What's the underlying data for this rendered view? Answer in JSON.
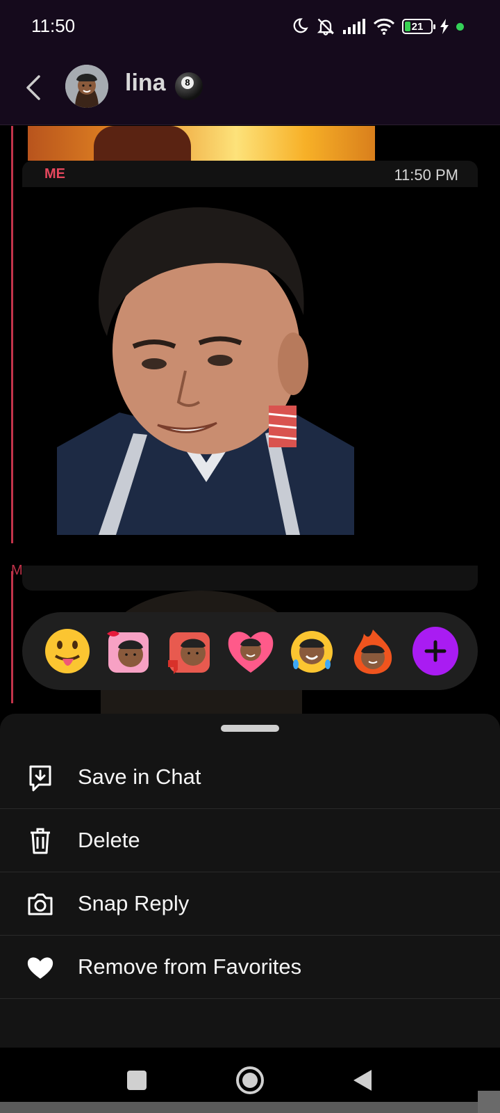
{
  "status_bar": {
    "time": "11:50",
    "battery": "21",
    "battery_level": 0.21,
    "icons": [
      "moon-icon",
      "bell-off-icon",
      "signal-icon",
      "wifi-icon",
      "battery-icon",
      "charging-icon",
      "green-dot-icon"
    ]
  },
  "header": {
    "contact_name": "lina",
    "eightball_label": "8",
    "back_icon": "back-chevron-icon"
  },
  "chat": {
    "message": {
      "sender": "ME",
      "time": "11:50 PM"
    },
    "second_sender_initial": "M"
  },
  "reactions": [
    {
      "name": "tongue-emoji",
      "glyph": "😛"
    },
    {
      "name": "bitmoji-kiss",
      "glyph": "💋"
    },
    {
      "name": "bitmoji-thumbs-down",
      "glyph": "👎"
    },
    {
      "name": "bitmoji-heart",
      "glyph": "❤"
    },
    {
      "name": "bitmoji-laughing",
      "glyph": "😂"
    },
    {
      "name": "bitmoji-fire",
      "glyph": "🔥"
    }
  ],
  "add_reaction_icon": "plus-icon",
  "menu": {
    "items": [
      {
        "label": "Save in Chat",
        "icon": "save-in-chat-icon"
      },
      {
        "label": "Delete",
        "icon": "trash-icon"
      },
      {
        "label": "Snap Reply",
        "icon": "camera-icon"
      },
      {
        "label": "Remove from Favorites",
        "icon": "heart-icon"
      }
    ]
  },
  "nav": {
    "buttons": [
      "recents-square-icon",
      "home-circle-icon",
      "back-triangle-icon"
    ]
  },
  "colors": {
    "accent_red": "#e5475d",
    "accent_purple": "#a91cf2",
    "header_bg": "#150a1c",
    "sheet_bg": "#141414"
  }
}
